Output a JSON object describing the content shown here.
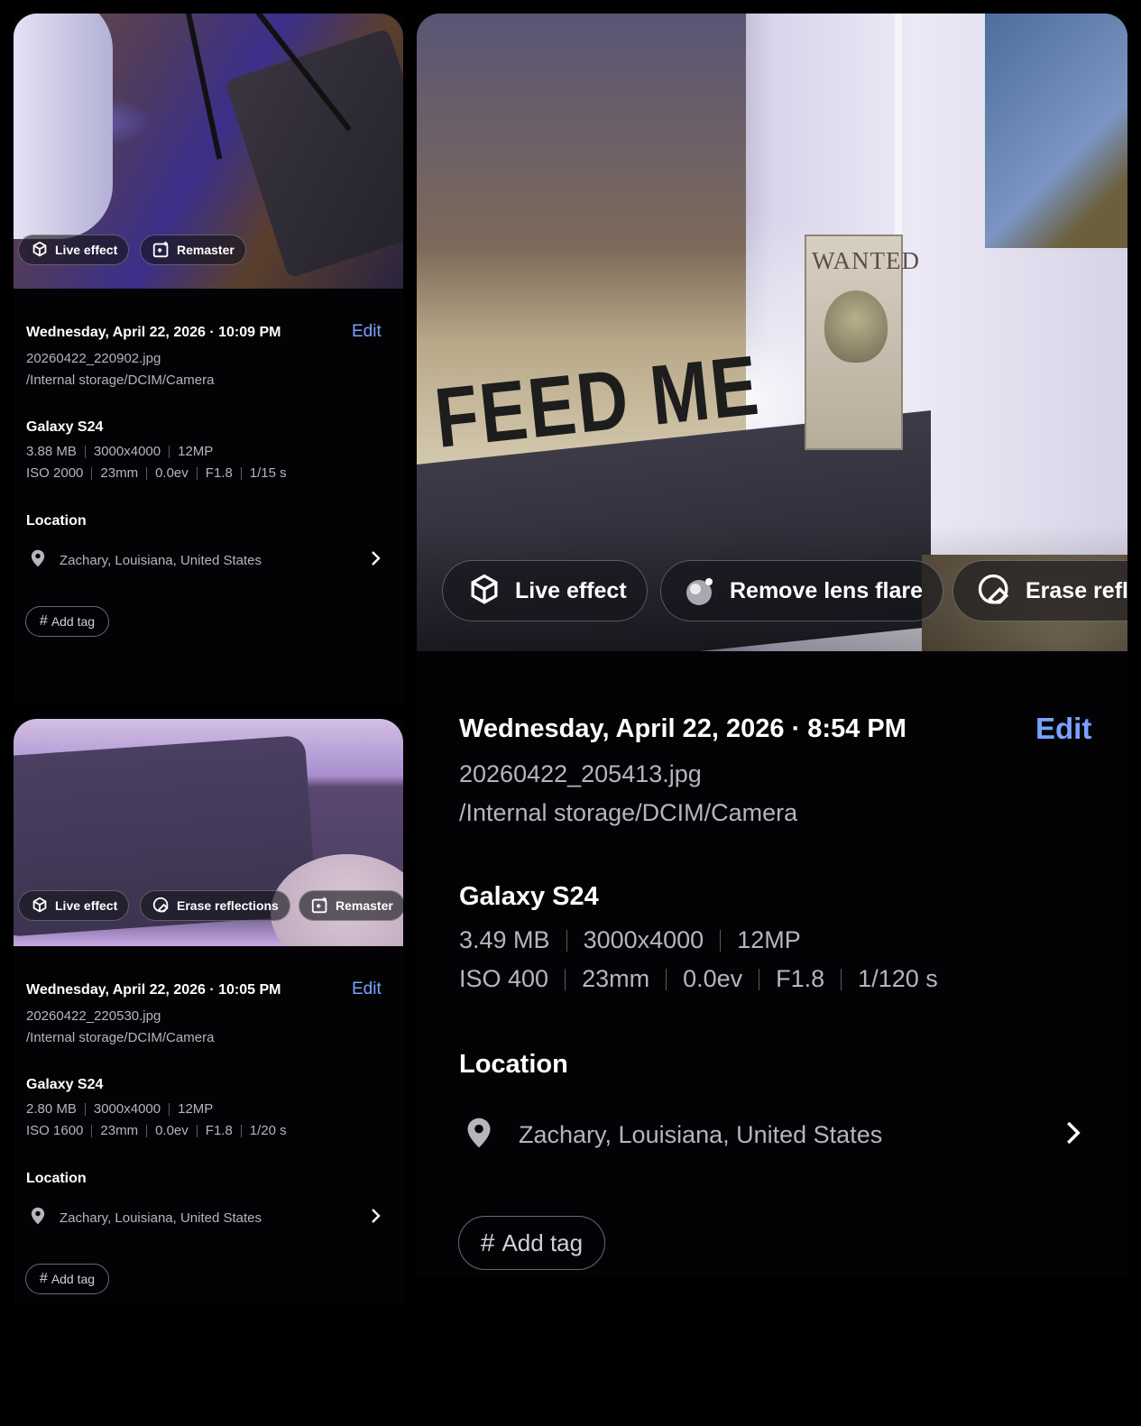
{
  "cards": [
    {
      "chips": [
        {
          "label": "Live effect",
          "icon": "live-effect-icon"
        },
        {
          "label": "Remaster",
          "icon": "remaster-icon"
        }
      ],
      "datetime": "Wednesday, April 22, 2026 · 10:09 PM",
      "edit_label": "Edit",
      "filename": "20260422_220902.jpg",
      "path": "/Internal storage/DCIM/Camera",
      "device": "Galaxy S24",
      "specs1": [
        "3.88 MB",
        "3000x4000",
        "12MP"
      ],
      "specs2": [
        "ISO 2000",
        "23mm",
        "0.0ev",
        "F1.8",
        "1/15 s"
      ],
      "location_heading": "Location",
      "location": "Zachary, Louisiana, United States",
      "tag_label": "Add tag"
    },
    {
      "chips": [
        {
          "label": "Live effect",
          "icon": "live-effect-icon"
        },
        {
          "label": "Erase reflections",
          "icon": "erase-reflections-icon"
        },
        {
          "label": "Remaster",
          "icon": "remaster-icon"
        }
      ],
      "datetime": "Wednesday, April 22, 2026 · 10:05 PM",
      "edit_label": "Edit",
      "filename": "20260422_220530.jpg",
      "path": "/Internal storage/DCIM/Camera",
      "device": "Galaxy S24",
      "specs1": [
        "2.80 MB",
        "3000x4000",
        "12MP"
      ],
      "specs2": [
        "ISO 1600",
        "23mm",
        "0.0ev",
        "F1.8",
        "1/20 s"
      ],
      "location_heading": "Location",
      "location": "Zachary, Louisiana, United States",
      "tag_label": "Add tag"
    },
    {
      "chips": [
        {
          "label": "Live effect",
          "icon": "live-effect-icon"
        },
        {
          "label": "Remove lens flare",
          "icon": "remove-lens-flare-icon"
        },
        {
          "label": "Erase refle",
          "icon": "erase-reflections-icon"
        }
      ],
      "photo_text": {
        "poster": "FEED ME",
        "sign": "WANTED"
      },
      "datetime": "Wednesday, April 22, 2026 · 8:54 PM",
      "edit_label": "Edit",
      "filename": "20260422_205413.jpg",
      "path": "/Internal storage/DCIM/Camera",
      "device": "Galaxy S24",
      "specs1": [
        "3.49 MB",
        "3000x4000",
        "12MP"
      ],
      "specs2": [
        "ISO 400",
        "23mm",
        "0.0ev",
        "F1.8",
        "1/120 s"
      ],
      "location_heading": "Location",
      "location": "Zachary, Louisiana, United States",
      "tag_label": "Add tag"
    }
  ],
  "colors": {
    "background": "#000000",
    "accent": "#7aa2ff",
    "secondary_text": "#b5b5bb"
  }
}
